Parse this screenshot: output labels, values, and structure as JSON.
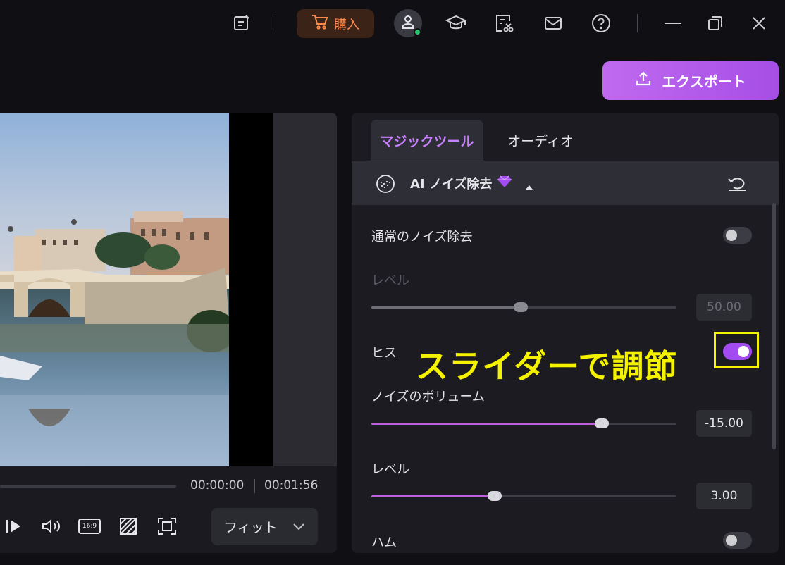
{
  "titlebar": {
    "buy_label": "購入",
    "icons": [
      "note-icon",
      "cart-icon",
      "user-icon",
      "graduation-cap-icon",
      "file-scissors-icon",
      "mail-icon",
      "help-icon",
      "minimize-icon",
      "restore-icon",
      "close-icon"
    ]
  },
  "export": {
    "label": "エクスポート"
  },
  "player": {
    "current_time": "00:00:00",
    "total_time": "00:01:56",
    "aspect_label": "16:9",
    "fit_label": "フィット"
  },
  "panel": {
    "tabs": [
      {
        "label": "マジックツール",
        "active": true
      },
      {
        "label": "オーディオ",
        "active": false
      }
    ],
    "section_title": "AI ノイズ除去",
    "normal_denoise": {
      "label": "通常のノイズ除去",
      "enabled": false
    },
    "normal_level": {
      "label": "レベル",
      "value": "50.00",
      "fraction": 0.49
    },
    "hiss": {
      "label": "ヒス",
      "enabled": true
    },
    "noise_volume": {
      "label": "ノイズのボリューム",
      "value": "-15.00",
      "fraction": 0.755
    },
    "hiss_level": {
      "label": "レベル",
      "value": "3.00",
      "fraction": 0.405
    },
    "hum": {
      "label": "ハム",
      "enabled": false
    }
  },
  "annotation": {
    "text": "スライダーで調節"
  },
  "colors": {
    "accent": "#a24bf0",
    "export": "#b85cec",
    "buy": "#ff8a4c",
    "annotation": "#f5f200"
  }
}
